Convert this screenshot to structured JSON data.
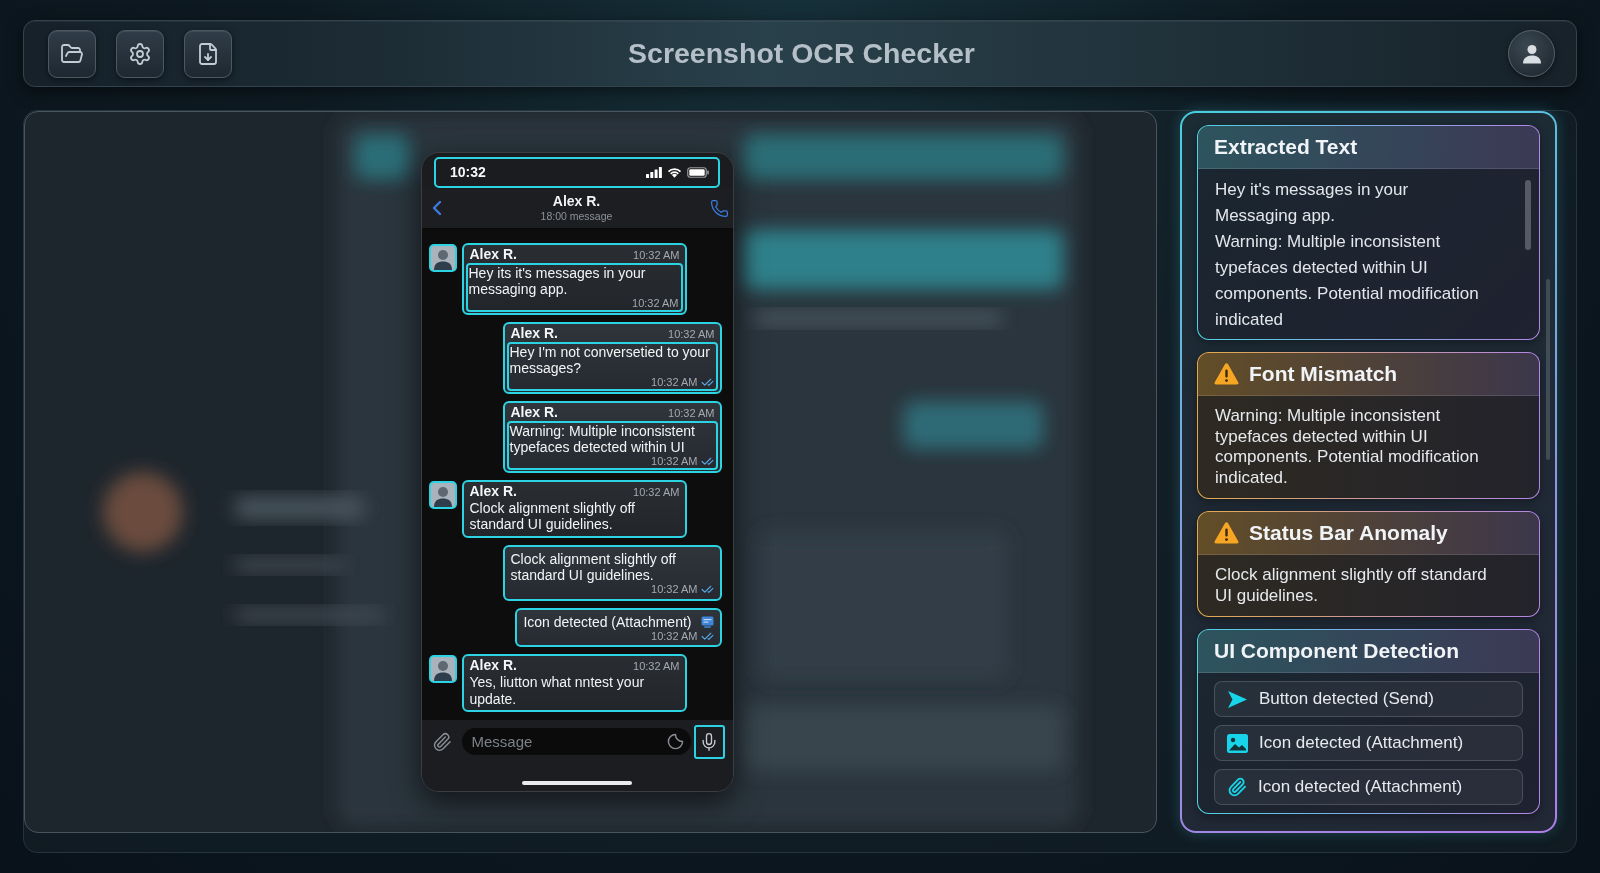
{
  "top_bar": {
    "title": "Screenshot OCR Checker"
  },
  "phone": {
    "status_bar": {
      "time": "10:32",
      "highlighted": true
    },
    "chat_header": {
      "name": "Alex R.",
      "subtitle": "18:00 message"
    },
    "messages": [
      {
        "kind": "incoming",
        "sender": "Alex R.",
        "time": "10:32 AM",
        "boxed": true,
        "text": "Hey its it's messages in your messaging app.",
        "attachment": false,
        "footer_time": "10:32 AM",
        "read": false
      },
      {
        "kind": "outgoing",
        "sender": "Alex R.",
        "time": "10:32 AM",
        "boxed": true,
        "text": "Hey I'm not conversetied to your messages?",
        "attachment": false,
        "footer_time": "10:32 AM",
        "read": true
      },
      {
        "kind": "outgoing",
        "sender": "Alex R.",
        "time": "10:32 AM",
        "boxed": true,
        "text": "Warning: Multiple inconsistent typefaces detected within UI",
        "attachment": false,
        "footer_time": "10:32 AM",
        "read": true
      },
      {
        "kind": "incoming",
        "sender": "Alex R.",
        "time": "10:32 AM",
        "boxed": false,
        "text": "Clock alignment slightly off standard UI guidelines.",
        "attachment": false
      },
      {
        "kind": "outgoing",
        "boxed": false,
        "text": "Clock alignment slightly off standard UI guidelines.",
        "attachment": false,
        "footer_time": "10:32 AM",
        "read": true
      },
      {
        "kind": "outgoing",
        "boxed": false,
        "text": "Icon detected (Attachment)",
        "attachment": true,
        "footer_time": "10:32 AM",
        "read": true
      },
      {
        "kind": "incoming",
        "sender": "Alex R.",
        "time": "10:32 AM",
        "boxed": false,
        "text": "Yes, liutton what nntest your update.",
        "attachment": false
      }
    ],
    "composer": {
      "placeholder": "Message",
      "mic_highlighted": true
    }
  },
  "analysis_panel": {
    "cards": [
      {
        "kind": "extracted",
        "title": "Extracted Text",
        "lines": [
          "Hey it's messages in your",
          "Messaging app.",
          "Warning: Multiple inconsistent",
          "typefaces detected within UI",
          "components. Potential modification",
          "indicated"
        ]
      },
      {
        "kind": "warning",
        "title": "Font Mismatch",
        "text": "Warning: Multiple inconsistent typefaces detected within UI components. Potential modification indicated."
      },
      {
        "kind": "warning",
        "title": "Status Bar Anomaly",
        "text": "Clock alignment slightly off standard UI guidelines."
      },
      {
        "kind": "detections",
        "title": "UI Component Detection",
        "items": [
          {
            "kind": "send",
            "label": "Button detected (Send)"
          },
          {
            "kind": "image",
            "label": "Icon detected (Attachment)"
          },
          {
            "kind": "clip",
            "label": "Icon detected (Attachment)"
          }
        ]
      }
    ]
  }
}
